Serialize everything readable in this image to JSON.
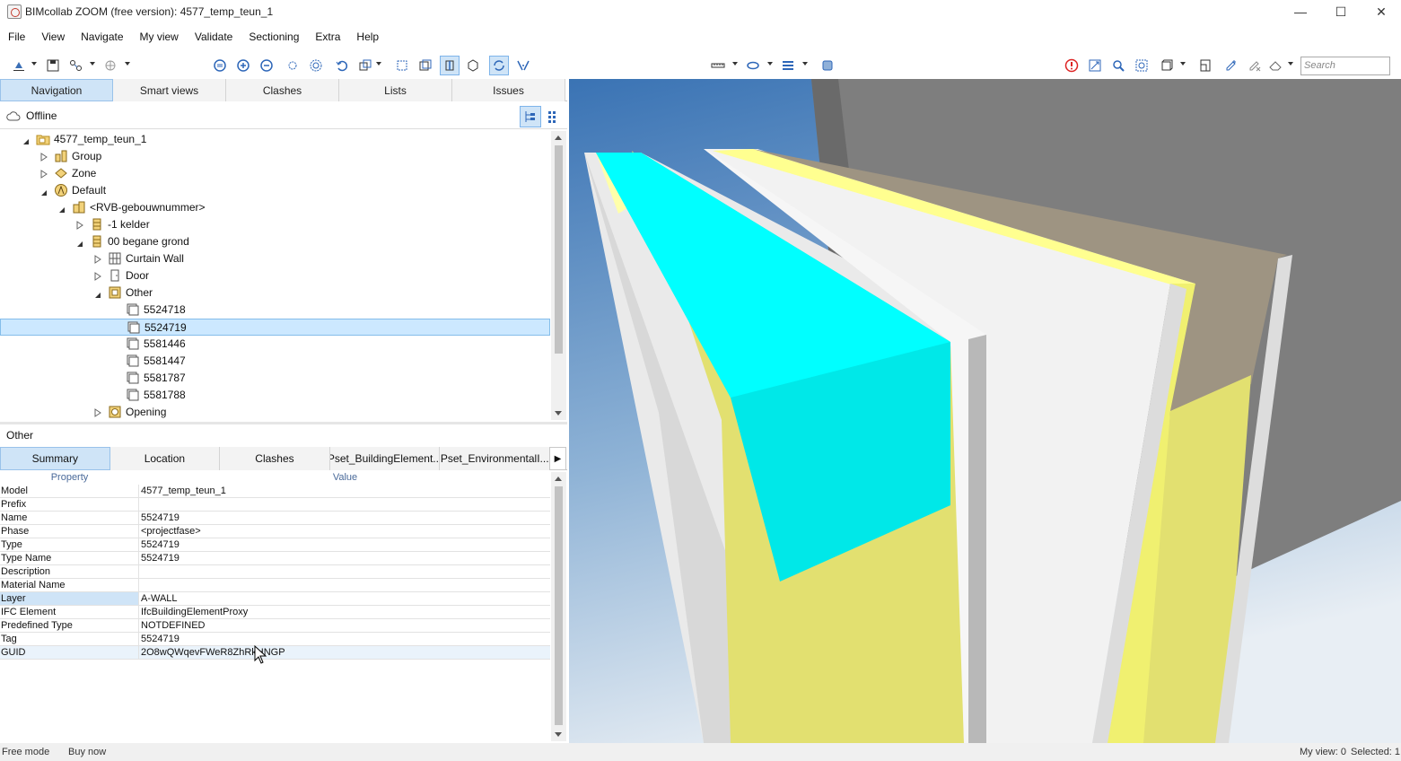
{
  "window": {
    "title": "BIMcollab ZOOM (free version): 4577_temp_teun_1",
    "controls": [
      "minimize-icon",
      "maximize-icon",
      "close-icon"
    ]
  },
  "menu": [
    "File",
    "View",
    "Navigate",
    "My view",
    "Validate",
    "Sectioning",
    "Extra",
    "Help"
  ],
  "toolbar": {
    "search_placeholder": "Search"
  },
  "nav_tabs": [
    "Navigation",
    "Smart views",
    "Clashes",
    "Lists",
    "Issues"
  ],
  "nav_selected_tab": "Navigation",
  "connection_status": "Offline",
  "tree": [
    {
      "label": "4577_temp_teun_1",
      "level": 0,
      "state": "expanded",
      "icon": "project-folder-icon"
    },
    {
      "label": "Group",
      "level": 1,
      "state": "collapsed",
      "icon": "group-icon"
    },
    {
      "label": "Zone",
      "level": 1,
      "state": "collapsed",
      "icon": "zone-icon"
    },
    {
      "label": "Default",
      "level": 1,
      "state": "expanded",
      "icon": "default-site-icon"
    },
    {
      "label": "<RVB-gebouwnummer>",
      "level": 2,
      "state": "expanded",
      "icon": "building-icon"
    },
    {
      "label": "-1 kelder",
      "level": 3,
      "state": "collapsed",
      "icon": "storey-icon"
    },
    {
      "label": "00 begane grond",
      "level": 3,
      "state": "expanded",
      "icon": "storey-icon"
    },
    {
      "label": "Curtain Wall",
      "level": 4,
      "state": "collapsed",
      "icon": "curtain-wall-icon"
    },
    {
      "label": "Door",
      "level": 4,
      "state": "collapsed",
      "icon": "door-icon"
    },
    {
      "label": "Other",
      "level": 4,
      "state": "expanded",
      "icon": "other-category-icon"
    },
    {
      "label": "5524718",
      "level": 5,
      "state": "leaf",
      "icon": "element-icon"
    },
    {
      "label": "5524719",
      "level": 5,
      "state": "leaf",
      "icon": "element-icon",
      "selected": true
    },
    {
      "label": "5581446",
      "level": 5,
      "state": "leaf",
      "icon": "element-icon"
    },
    {
      "label": "5581447",
      "level": 5,
      "state": "leaf",
      "icon": "element-icon"
    },
    {
      "label": "5581787",
      "level": 5,
      "state": "leaf",
      "icon": "element-icon"
    },
    {
      "label": "5581788",
      "level": 5,
      "state": "leaf",
      "icon": "element-icon"
    },
    {
      "label": "Opening",
      "level": 4,
      "state": "collapsed",
      "icon": "opening-icon"
    }
  ],
  "properties": {
    "title": "Other",
    "tabs": [
      "Summary",
      "Location",
      "Clashes",
      "Pset_BuildingElement...",
      "Pset_EnvironmentalI..."
    ],
    "selected_tab": "Summary",
    "columns": {
      "property": "Property",
      "value": "Value"
    },
    "rows": [
      {
        "property": "Model",
        "value": "4577_temp_teun_1"
      },
      {
        "property": "Prefix",
        "value": ""
      },
      {
        "property": "Name",
        "value": "5524719"
      },
      {
        "property": "Phase",
        "value": "<projectfase>"
      },
      {
        "property": "Type",
        "value": "5524719"
      },
      {
        "property": "Type Name",
        "value": "5524719"
      },
      {
        "property": "Description",
        "value": ""
      },
      {
        "property": "Material Name",
        "value": ""
      },
      {
        "property": "Layer",
        "value": "A-WALL"
      },
      {
        "property": "IFC Element",
        "value": "IfcBuildingElementProxy"
      },
      {
        "property": "Predefined Type",
        "value": "NOTDEFINED"
      },
      {
        "property": "Tag",
        "value": "5524719"
      },
      {
        "property": "GUID",
        "value": "2O8wQWqevFWeR8ZhRkHNGP"
      }
    ]
  },
  "status": {
    "mode": "Free mode",
    "buy": "Buy now",
    "my_view": "My view: 0",
    "selected": "Selected: 1"
  },
  "colors": {
    "accent": "#cfe4f7",
    "selection": "#cce8ff",
    "highlight_cyan": "#00ffff",
    "wall_yellow": "#e2e070",
    "folder_yellow": "#e8c44a"
  }
}
